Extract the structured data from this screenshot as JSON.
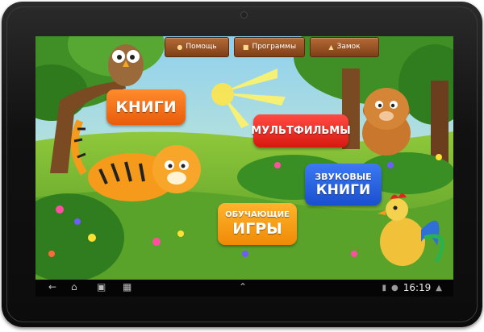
{
  "device": {
    "type": "tablet"
  },
  "topbar": {
    "help_label": "Помощь",
    "programs_label": "Программы",
    "lock_label": "Замок"
  },
  "categories": {
    "books": "КНИГИ",
    "cartoons": "МУЛЬТФИЛЬМЫ",
    "audio_line1": "ЗВУКОВЫЕ",
    "audio_line2": "КНИГИ",
    "games_line1": "ОБУЧАЮЩИЕ",
    "games_line2": "ИГРЫ"
  },
  "status_bar": {
    "time": "16:19",
    "icons": [
      "back-icon",
      "home-icon",
      "recent-apps-icon",
      "screenshot-icon",
      "chevron-up-icon",
      "sd-card-icon",
      "android-icon",
      "wifi-icon"
    ]
  },
  "colors": {
    "books": "#f07312",
    "cartoons": "#e52b22",
    "audio_books": "#2e64e6",
    "learning_games": "#f8a31a",
    "top_button": "#9b5427"
  }
}
